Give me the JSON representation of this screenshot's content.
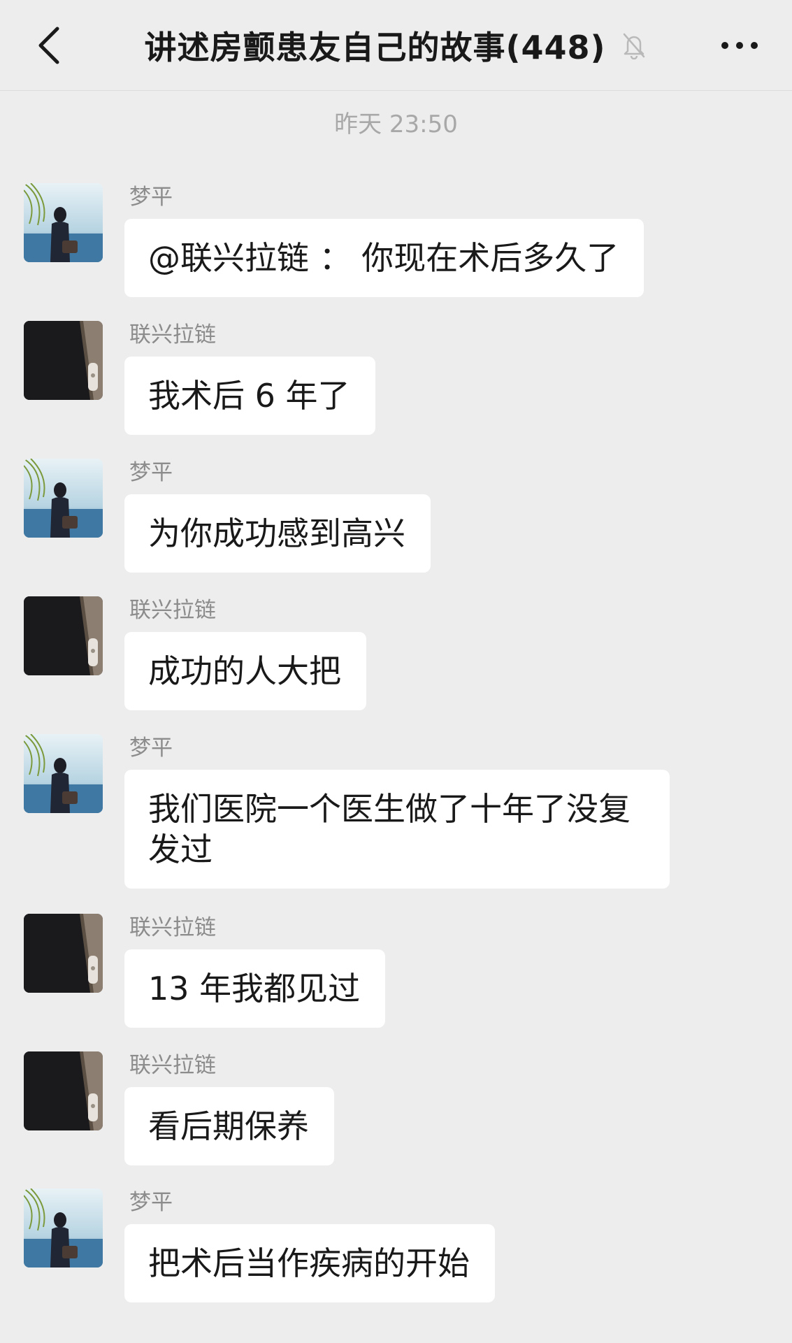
{
  "header": {
    "title": "讲述房颤患友自己的故事(448)",
    "back_icon": "chevron-left-icon",
    "mute_icon": "bell-off-icon",
    "more_icon": "more-dots-icon"
  },
  "timestamp": "昨天 23:50",
  "colors": {
    "background": "#ededed",
    "bubble": "#ffffff",
    "sender_name": "#8c8c8c",
    "timestamp": "#a8a8a8"
  },
  "messages": [
    {
      "sender": "梦平",
      "avatar": "lake-photo-avatar",
      "text": "@联兴拉链 ： 你现在术后多久了"
    },
    {
      "sender": "联兴拉链",
      "avatar": "dark-coat-avatar",
      "text": "我术后 6 年了"
    },
    {
      "sender": "梦平",
      "avatar": "lake-photo-avatar",
      "text": "为你成功感到高兴"
    },
    {
      "sender": "联兴拉链",
      "avatar": "dark-coat-avatar",
      "text": "成功的人大把"
    },
    {
      "sender": "梦平",
      "avatar": "lake-photo-avatar",
      "text": "我们医院一个医生做了十年了没复发过"
    },
    {
      "sender": "联兴拉链",
      "avatar": "dark-coat-avatar",
      "text": "13 年我都见过"
    },
    {
      "sender": "联兴拉链",
      "avatar": "dark-coat-avatar",
      "text": "看后期保养"
    },
    {
      "sender": "梦平",
      "avatar": "lake-photo-avatar",
      "text": "把术后当作疾病的开始"
    }
  ]
}
